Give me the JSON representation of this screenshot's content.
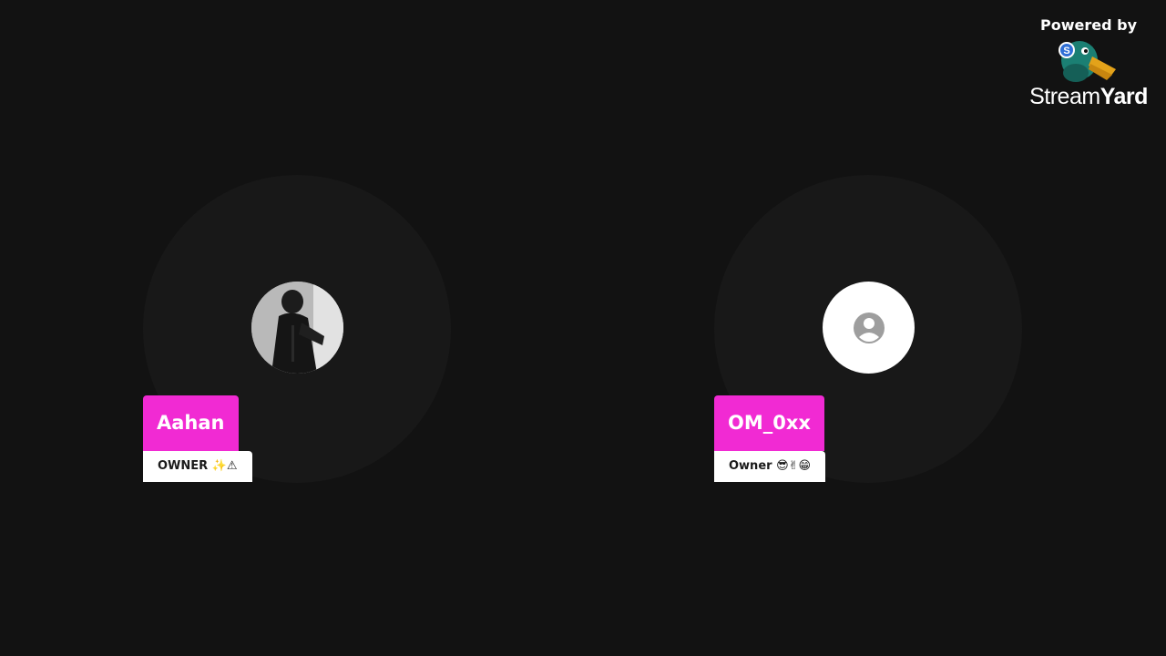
{
  "participants": [
    {
      "name": "Aahan",
      "role": "OWNER ✨⚠",
      "avatar_type": "photo"
    },
    {
      "name": "OM_0xx",
      "role": "Owner 😎✌😁",
      "avatar_type": "placeholder-person-icon"
    }
  ],
  "branding": {
    "powered_by": "Powered by",
    "wordmark_light": "Stream",
    "wordmark_bold": "Yard",
    "logo_icon": "duck-mascot-icon"
  },
  "colors": {
    "background": "#121212",
    "tile": "#181818",
    "name_tag": "#f12ad3",
    "role_tag": "#ffffff",
    "placeholder_icon": "#9e9e9e"
  }
}
